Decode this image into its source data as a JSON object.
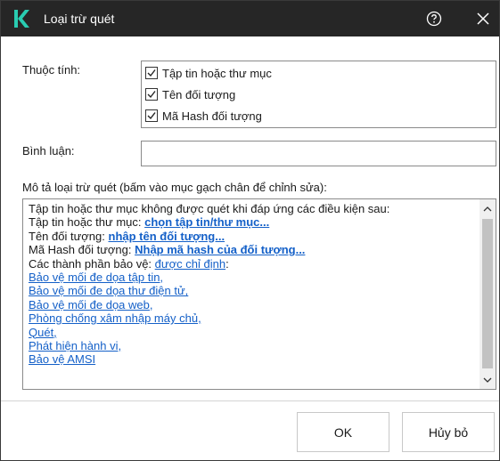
{
  "window": {
    "title": "Loại trừ quét",
    "brand_color": "#29ccb1",
    "titlebar_color": "#262626"
  },
  "properties": {
    "label": "Thuộc tính:",
    "items": [
      {
        "label": "Tập tin hoặc thư mục",
        "checked": true
      },
      {
        "label": "Tên đối tượng",
        "checked": true
      },
      {
        "label": "Mã Hash đối tượng",
        "checked": true
      }
    ]
  },
  "comment": {
    "label": "Bình luận:",
    "value": ""
  },
  "description": {
    "label": "Mô tả loại trừ quét (bấm vào mục gạch chân để chỉnh sửa):",
    "intro": "Tập tin hoặc thư mục không được quét khi đáp ứng các điều kiện sau:",
    "file_label": "Tập tin hoặc thư mục: ",
    "file_link": "chọn tập tin/thư mục...",
    "name_label": "Tên đối tượng: ",
    "name_link": "nhập tên đối tượng...",
    "hash_label": "Mã Hash đối tượng: ",
    "hash_link": "Nhập mã hash của đối tượng...",
    "components_label": "Các thành phần bảo vệ: ",
    "components_link": "được chỉ định",
    "components_suffix": ":",
    "components": [
      "Bảo vệ mối đe dọa tập tin,",
      "Bảo vệ mối đe dọa thư điện tử,",
      "Bảo vệ mối đe dọa web,",
      "Phòng chống xâm nhập máy chủ,",
      "Quét,",
      "Phát hiện hành vi,",
      "Bảo vệ AMSI"
    ],
    "link_color": "#1460c8"
  },
  "buttons": {
    "ok": "OK",
    "cancel": "Hủy bỏ"
  },
  "icons": {
    "logo": "kaspersky-k-logo",
    "help": "help-circle-icon",
    "close": "close-x-icon",
    "scroll_up": "chevron-up-icon",
    "scroll_down": "chevron-down-icon",
    "check": "checkmark-icon"
  }
}
